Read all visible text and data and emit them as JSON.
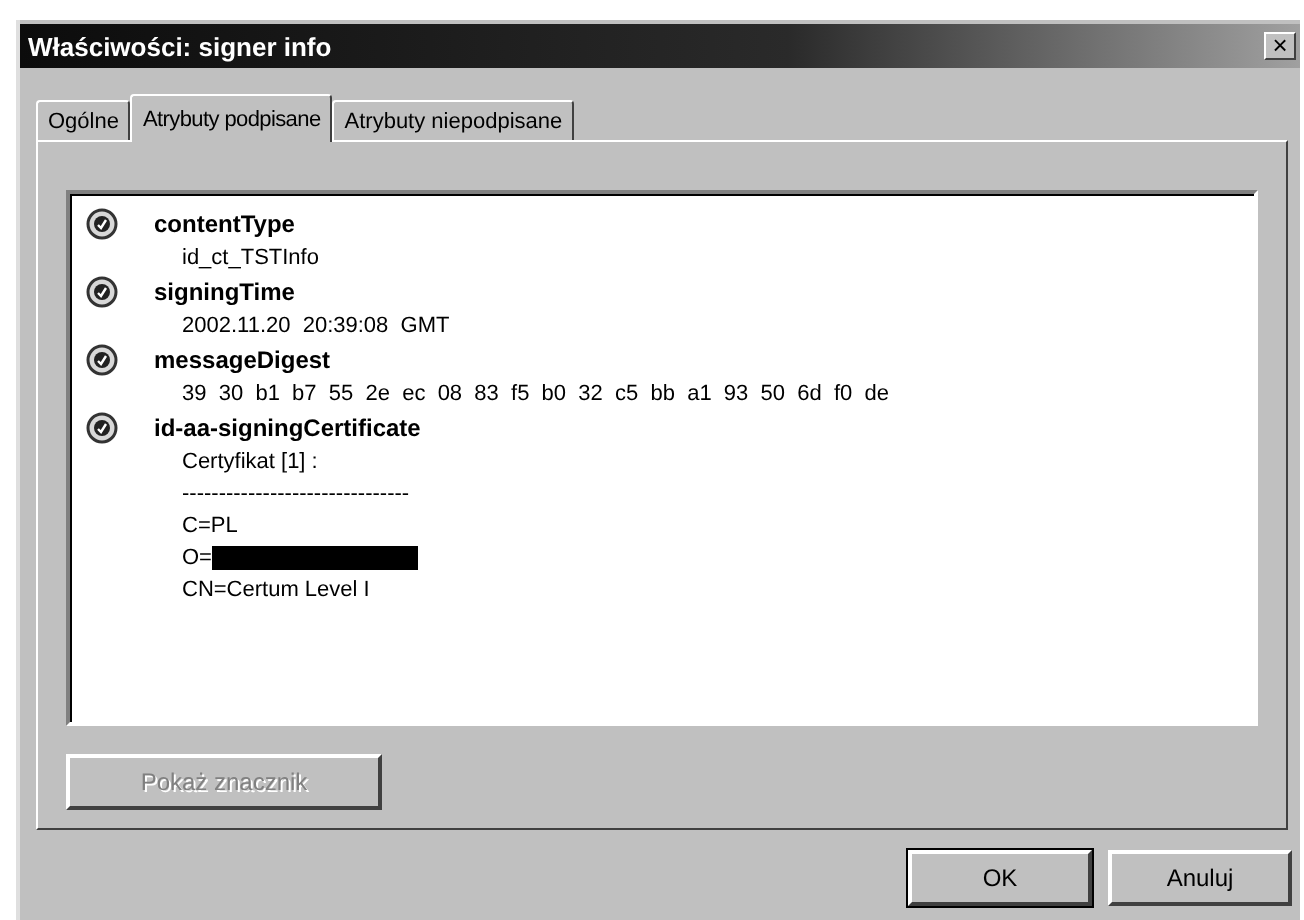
{
  "window": {
    "title": "Właściwości: signer info",
    "close": "×"
  },
  "tabs": [
    {
      "label": "Ogólne",
      "selected": false
    },
    {
      "label": "Atrybuty podpisane",
      "selected": true
    },
    {
      "label": "Atrybuty niepodpisane",
      "selected": false
    }
  ],
  "attributes": [
    {
      "name": "contentType",
      "lines": [
        {
          "text": "id_ct_TSTInfo",
          "redacted": false
        }
      ]
    },
    {
      "name": "signingTime",
      "lines": [
        {
          "text": "2002.11.20  20:39:08  GMT",
          "redacted": false
        }
      ]
    },
    {
      "name": "messageDigest",
      "lines": [
        {
          "text": "39  30  b1  b7  55  2e  ec  08  83  f5  b0  32  c5  bb  a1  93  50  6d  f0  de",
          "redacted": false
        }
      ]
    },
    {
      "name": "id-aa-signingCertificate",
      "lines": [
        {
          "text": "Certyfikat [1] :",
          "redacted": false
        },
        {
          "text": "-------------------------------",
          "redacted": false
        },
        {
          "text": "C=PL",
          "redacted": false
        },
        {
          "text": "O=",
          "redacted": true
        },
        {
          "text": "CN=Certum Level I",
          "redacted": false
        }
      ]
    }
  ],
  "show_button": {
    "label": "Pokaż znacznik",
    "disabled": true
  },
  "buttons": [
    {
      "label": "OK",
      "default": true
    },
    {
      "label": "Anuluj",
      "default": false
    }
  ]
}
